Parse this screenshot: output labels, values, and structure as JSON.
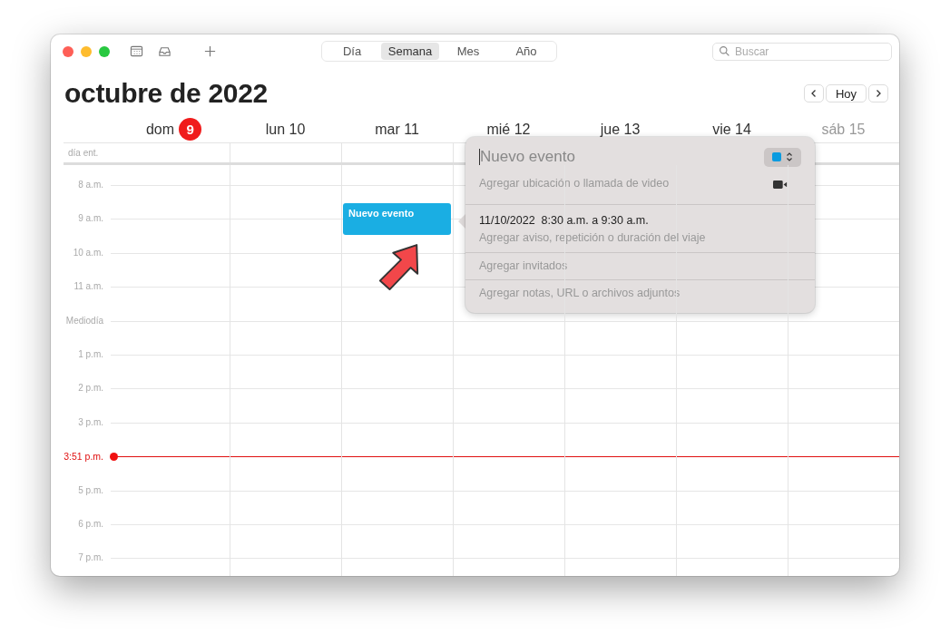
{
  "toolbar": {
    "views": [
      {
        "label": "Día",
        "selected": false
      },
      {
        "label": "Semana",
        "selected": true
      },
      {
        "label": "Mes",
        "selected": false
      },
      {
        "label": "Año",
        "selected": false
      }
    ],
    "search": {
      "placeholder": "Buscar"
    }
  },
  "title": "octubre de 2022",
  "nav": {
    "today": "Hoy"
  },
  "all_day_label": "día ent.",
  "days": [
    {
      "label": "dom",
      "date": "9",
      "today": true,
      "dimmed": false
    },
    {
      "label": "lun 10",
      "today": false,
      "dimmed": false
    },
    {
      "label": "mar 11",
      "today": false,
      "dimmed": false,
      "events": [
        {
          "title": "Nuevo evento"
        }
      ]
    },
    {
      "label": "mié 12",
      "today": false,
      "dimmed": false
    },
    {
      "label": "jue 13",
      "today": false,
      "dimmed": false
    },
    {
      "label": "vie 14",
      "today": false,
      "dimmed": false
    },
    {
      "label": "sáb 15",
      "today": false,
      "dimmed": true
    }
  ],
  "hours": [
    {
      "label": "8 a.m.",
      "kind": "hour"
    },
    {
      "label": "9 a.m.",
      "kind": "hour"
    },
    {
      "label": "10 a.m.",
      "kind": "hour"
    },
    {
      "label": "11 a.m.",
      "kind": "hour"
    },
    {
      "label": "Mediodía",
      "kind": "hour"
    },
    {
      "label": "1 p.m.",
      "kind": "hour"
    },
    {
      "label": "2 p.m.",
      "kind": "hour"
    },
    {
      "label": "3 p.m.",
      "kind": "hour"
    },
    {
      "label": "3:51 p.m.",
      "kind": "now"
    },
    {
      "label": "5 p.m.",
      "kind": "hour"
    },
    {
      "label": "6 p.m.",
      "kind": "hour"
    },
    {
      "label": "7 p.m.",
      "kind": "hour"
    }
  ],
  "popover": {
    "title": "Nuevo evento",
    "color": "#0a9be0",
    "location_placeholder": "Agregar ubicación o llamada de video",
    "when": "11/10/2022  8:30 a.m. a 9:30 a.m.",
    "alert_placeholder": "Agregar aviso, repetición o duración del viaje",
    "invitees_placeholder": "Agregar invitados",
    "notes_placeholder": "Agregar notas, URL o archivos adjuntos"
  }
}
